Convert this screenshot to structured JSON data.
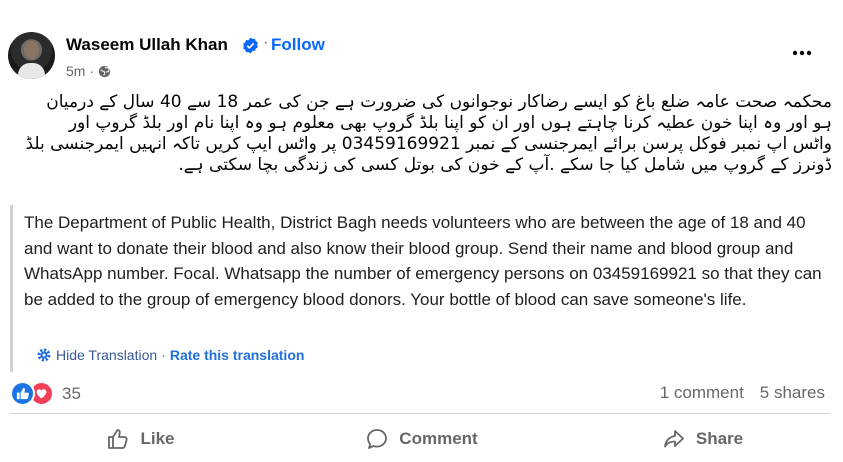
{
  "post": {
    "author": "Waseem Ullah Khan",
    "follow_label": "Follow",
    "separator": "·",
    "time": "5m ·",
    "urdu_lines": [
      "محکمہ صحت عامہ ضلع باغ کو ایسے رضاکار نوجوانوں کی ضرورت ہے جن کی عمر 18 سے 40 سال کے درمیان",
      "ہو اور وہ اپنا خون عطیہ کرنا چاہتے ہوں اور ان کو اپنا بلڈ گروپ بھی معلوم ہو وہ اپنا نام اور بلڈ گروپ اور",
      "واٹس اپ نمبر فوکل پرسن برائے ایمرجنسی کے نمبر 03459169921 پر واٹس ایپ کریں تاکہ انہیں ایمرجنسی بلڈ",
      "ڈونرز کے گروپ میں شامل کیا جا سکے .آپ کے خون کی بوتل کسی کی زندگی بچا سکتی ہے."
    ],
    "translation": "The Department of Public Health, District Bagh needs volunteers who are between the age of 18 and 40 and want to donate their blood and also know their blood group. Send their name and blood group and WhatsApp number. Focal. Whatsapp the number of emergency persons on 03459169921 so that they can be added to the group of emergency blood donors. Your bottle of blood can save someone's life.",
    "hide_translation": "Hide Translation",
    "link_separator": "·",
    "rate_translation": "Rate this translation"
  },
  "engagement": {
    "reaction_count": "35",
    "comments": "1 comment",
    "shares": "5 shares"
  },
  "actions": {
    "like": "Like",
    "comment": "Comment",
    "share": "Share"
  },
  "colors": {
    "link_blue": "#0866ff",
    "like_blue": "#1b74e4",
    "love_red": "#f33e58",
    "muted": "#65676b"
  },
  "icons": [
    "verified-badge-icon",
    "globe-icon",
    "more-options-icon",
    "gear-icon",
    "like-reaction-icon",
    "love-reaction-icon",
    "thumbs-up-icon",
    "comment-icon",
    "share-icon"
  ]
}
